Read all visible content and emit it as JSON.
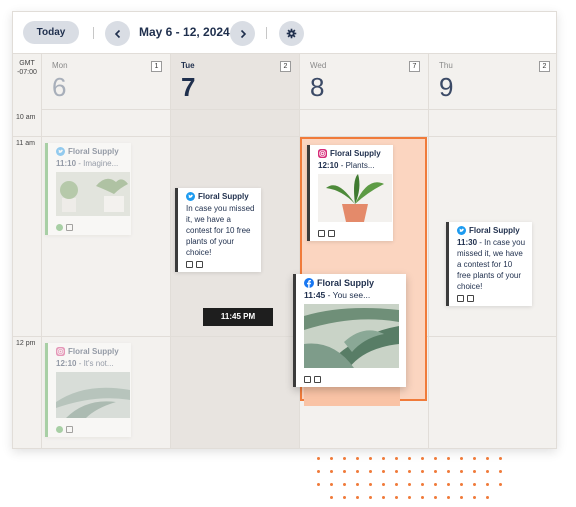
{
  "toolbar": {
    "today": "Today",
    "range": "May 6 - 12, 2024",
    "prev_icon": "chevron-left-icon",
    "next_icon": "chevron-right-icon",
    "settings_icon": "gear-icon"
  },
  "timezone": {
    "line1": "GMT",
    "line2": "-07:00"
  },
  "days": [
    {
      "name": "Mon",
      "num": "6",
      "count": "1"
    },
    {
      "name": "Tue",
      "num": "7",
      "count": "2"
    },
    {
      "name": "Wed",
      "num": "8",
      "count": "7"
    },
    {
      "name": "Thu",
      "num": "9",
      "count": "2"
    }
  ],
  "times": [
    "10 am",
    "11 am",
    "12 pm"
  ],
  "posts": {
    "mon_1110": {
      "account": "Floral Supply",
      "time": "11:10",
      "text": " - Imagine..."
    },
    "mon_1210": {
      "account": "Floral Supply",
      "time": "12:10",
      "text": " - It's not..."
    },
    "tue_post": {
      "account": "Floral Supply",
      "text": "In case you missed it, we have a contest for 10 free plants of your choice!"
    },
    "wed_1210": {
      "account": "Floral Supply",
      "time": "12:10",
      "text": " - Plants..."
    },
    "wed_1145": {
      "account": "Floral Supply",
      "time": "11:45",
      "text": " - You see..."
    },
    "thu_1130": {
      "account": "Floral Supply",
      "time": "11:30",
      "text": " - In case you missed it, we have a contest for 10 free plants of your choice!"
    }
  },
  "drag_tooltip": "11:45 PM",
  "colors": {
    "accent": "#f07b3a",
    "drop_zone": "#fbd5c0",
    "twitter": "#1d9bf0",
    "instagram": "#d62976",
    "facebook": "#1877f2",
    "navy": "#1f2f4d"
  }
}
